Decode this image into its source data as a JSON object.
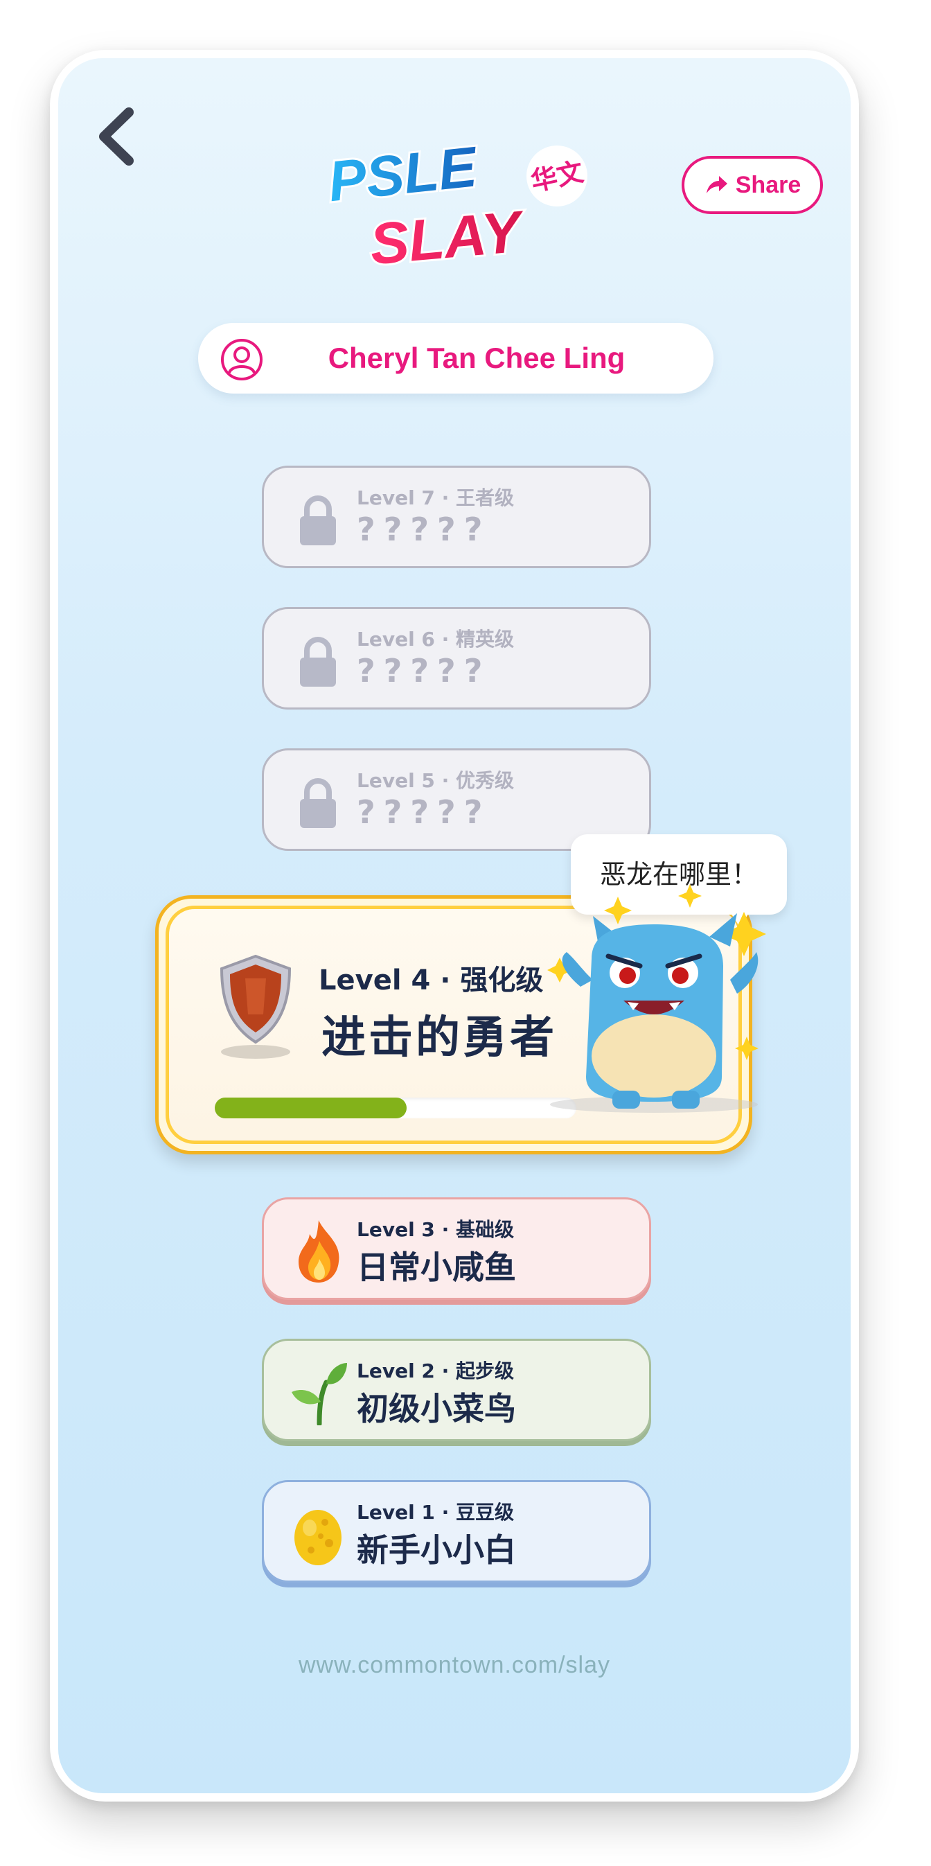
{
  "header": {
    "logo": {
      "line1": "PSLE",
      "line2": "SLAY",
      "tag": "华文"
    },
    "share_label": "Share"
  },
  "user": {
    "name": "Cheryl Tan Chee Ling"
  },
  "levels": [
    {
      "title": "Level 7 · 王者级",
      "name": "?????",
      "state": "locked"
    },
    {
      "title": "Level 6 · 精英级",
      "name": "?????",
      "state": "locked"
    },
    {
      "title": "Level 5 · 优秀级",
      "name": "?????",
      "state": "locked"
    },
    {
      "title": "Level 4 · 强化级",
      "name": "进击的勇者",
      "state": "current",
      "progress": 0.53
    },
    {
      "title": "Level 3 · 基础级",
      "name": "日常小咸鱼",
      "state": "completed",
      "icon": "fire-icon"
    },
    {
      "title": "Level 2 · 起步级",
      "name": "初级小菜鸟",
      "state": "completed",
      "icon": "sprout-icon"
    },
    {
      "title": "Level 1 · 豆豆级",
      "name": "新手小小白",
      "state": "completed",
      "icon": "egg-icon"
    }
  ],
  "speech_bubble": "恶龙在哪里！",
  "footer": {
    "url": "www.commontown.com/slay"
  },
  "colors": {
    "brand_pink": "#e8197e",
    "background_top": "#eaf6fd",
    "background_bottom": "#c9e7fa",
    "current_border": "#f3b320",
    "progress": "#83b21a",
    "text_dark": "#1c2a4a"
  }
}
